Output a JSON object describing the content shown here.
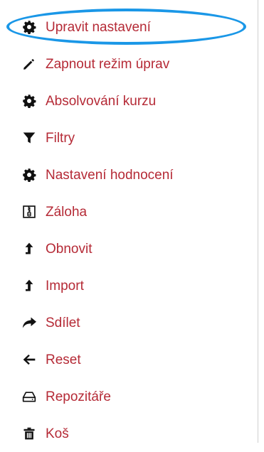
{
  "menu": {
    "items": [
      {
        "label": "Upravit nastavení",
        "icon": "gear-icon",
        "highlighted": true
      },
      {
        "label": "Zapnout režim úprav",
        "icon": "pencil-icon"
      },
      {
        "label": "Absolvování kurzu",
        "icon": "gear-icon"
      },
      {
        "label": "Filtry",
        "icon": "filter-icon"
      },
      {
        "label": "Nastavení hodnocení",
        "icon": "gear-icon"
      },
      {
        "label": "Záloha",
        "icon": "archive-file-icon"
      },
      {
        "label": "Obnovit",
        "icon": "level-up-arrow-icon"
      },
      {
        "label": "Import",
        "icon": "level-up-arrow-icon"
      },
      {
        "label": "Sdílet",
        "icon": "share-arrow-icon"
      },
      {
        "label": "Reset",
        "icon": "arrow-left-icon"
      },
      {
        "label": "Repozitáře",
        "icon": "hard-drive-icon"
      },
      {
        "label": "Koš",
        "icon": "trash-icon"
      }
    ]
  },
  "colors": {
    "label": "#b52a36",
    "icon": "#111111",
    "highlight": "#1a97e7"
  }
}
